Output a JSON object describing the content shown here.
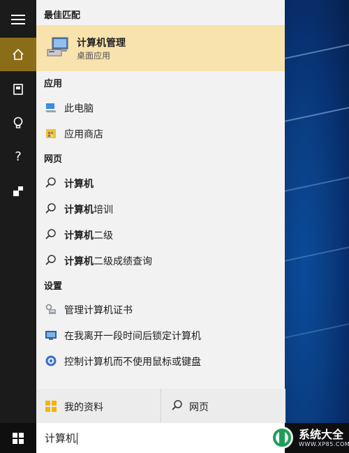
{
  "sections": {
    "best_match": "最佳匹配",
    "apps": "应用",
    "web": "网页",
    "settings": "设置"
  },
  "best_match": {
    "title": "计算机管理",
    "subtitle": "桌面应用"
  },
  "apps": [
    {
      "label": "此电脑",
      "icon": "computer-icon"
    },
    {
      "label": "应用商店",
      "icon": "store-icon"
    }
  ],
  "web": [
    {
      "bold": "计算机",
      "rest": ""
    },
    {
      "bold": "计算机",
      "rest": "培训"
    },
    {
      "bold": "计算机",
      "rest": "二级"
    },
    {
      "bold": "计算机",
      "rest": "二级成绩查询"
    }
  ],
  "settings": [
    {
      "label": "管理计算机证书",
      "icon": "certificate-icon"
    },
    {
      "label": "在我离开一段时间后锁定计算机",
      "icon": "lock-screen-icon"
    },
    {
      "label": "控制计算机而不使用鼠标或键盘",
      "icon": "ease-of-access-icon"
    }
  ],
  "bottom": {
    "my_stuff": "我的资料",
    "web": "网页"
  },
  "search": {
    "query": "计算机"
  },
  "watermark": {
    "brand": "系统大全",
    "url": "WWW.XP85.COM"
  },
  "colors": {
    "best_match_bg": "#f8e2ad",
    "rail_active": "#8a6d18",
    "panel_bg": "#f2f2f2"
  }
}
